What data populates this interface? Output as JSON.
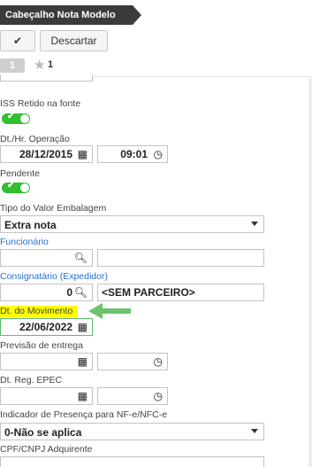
{
  "header": {
    "title": "Cabeçalho Nota Modelo"
  },
  "toolbar": {
    "confirm_symbol": "✔",
    "discard_label": "Descartar"
  },
  "tabs": {
    "active_number": "1",
    "star_count": "1"
  },
  "fields": {
    "iss_retido": {
      "label": "ISS Retido na fonte",
      "on": true
    },
    "dt_operacao": {
      "label": "Dt./Hr. Operação",
      "date": "28/12/2015",
      "time": "09:01"
    },
    "pendente": {
      "label": "Pendente",
      "on": true
    },
    "tipo_valor_embalagem": {
      "label": "Tipo do Valor Embalagem",
      "value": "Extra nota"
    },
    "funcionario": {
      "label": "Funcionário",
      "code": "",
      "name": ""
    },
    "consignatario": {
      "label": "Consignatário (Expedidor)",
      "code": "0",
      "name": "<SEM PARCEIRO>"
    },
    "dt_movimento": {
      "label": "Dt. do Movimento",
      "date": "22/06/2022"
    },
    "previsao_entrega": {
      "label": "Previsão de entrega",
      "date": "",
      "time": ""
    },
    "dt_reg_epec": {
      "label": "Dt. Reg. EPEC",
      "date": "",
      "time": ""
    },
    "indicador_presenca": {
      "label": "Indicador de Presença para NF-e/NFC-e",
      "value": "0-Não se aplica"
    },
    "cpf_cnpj": {
      "label": "CPF/CNPJ Adquirente"
    }
  },
  "colors": {
    "toggle_on": "#2fbf2f",
    "link": "#2a6fd1",
    "highlight": "#ffff00",
    "arrow": "#6cc46c"
  }
}
